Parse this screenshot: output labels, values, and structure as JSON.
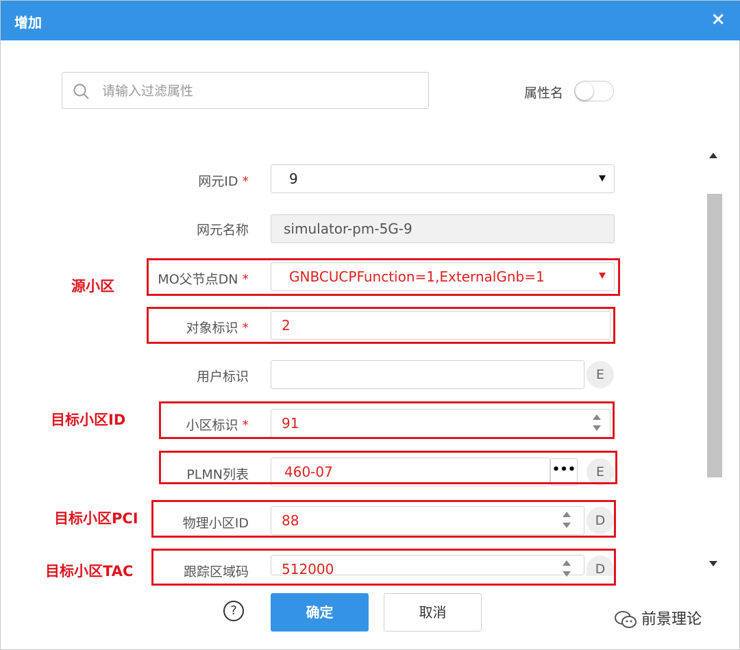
{
  "dialog": {
    "title": "增加",
    "close_icon": "×"
  },
  "filter": {
    "placeholder": "请输入过滤属性",
    "toggle_label": "属性名",
    "toggle_on": false
  },
  "fields": {
    "ne_id": {
      "label": "网元ID",
      "value": "9"
    },
    "ne_name": {
      "label": "网元名称",
      "value": "simulator-pm-5G-9"
    },
    "mo_parent": {
      "label": "MO父节点DN",
      "value": "GNBCUCPFunction=1,ExternalGnb=1"
    },
    "object_id": {
      "label": "对象标识",
      "value": "2"
    },
    "user_id": {
      "label": "用户标识",
      "value": "",
      "btn": "E"
    },
    "cell_id": {
      "label": "小区标识",
      "value": "91"
    },
    "plmn": {
      "label": "PLMN列表",
      "value": "460-07",
      "dots": "•••",
      "btn": "E"
    },
    "pci": {
      "label": "物理小区ID",
      "value": "88",
      "btn": "D"
    },
    "tac": {
      "label": "跟踪区域码",
      "value": "512000",
      "btn": "D"
    },
    "required_mark": "*"
  },
  "annotations": {
    "source_cell": "源小区",
    "target_cell_id": "目标小区ID",
    "target_pci": "目标小区PCI",
    "target_tac": "目标小区TAC"
  },
  "buttons": {
    "help": "?",
    "ok": "确定",
    "cancel": "取消"
  },
  "watermark": "前景理论",
  "colors": {
    "accent": "#3593e6",
    "highlight": "#e0141e"
  }
}
